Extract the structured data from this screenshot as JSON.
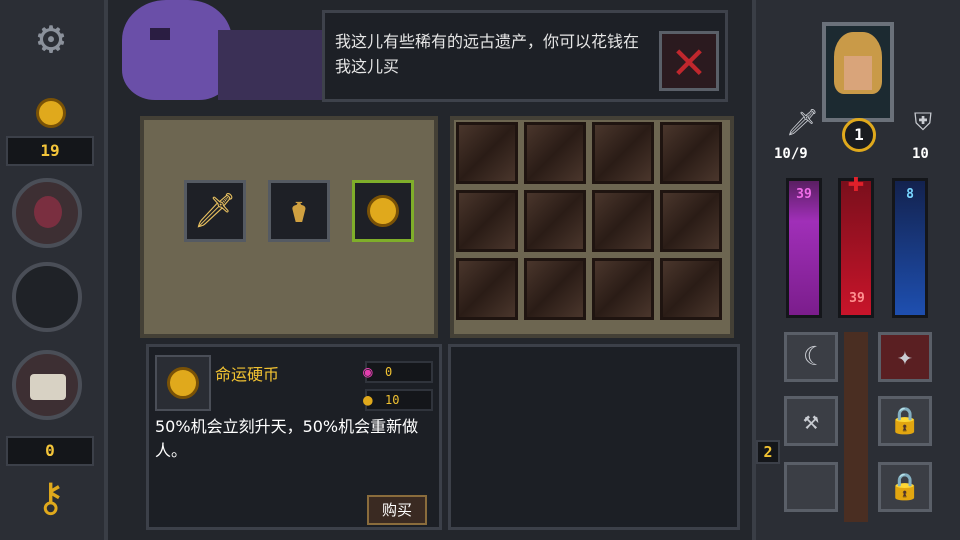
{
  "sidebar": {
    "gold": "19",
    "keys": "0"
  },
  "dialog": {
    "text": "我这儿有些稀有的远古遗产，你可以花钱在我这儿买"
  },
  "shop_items": [
    {
      "name": "sword-item",
      "glyph": "🗡"
    },
    {
      "name": "lantern-item",
      "glyph": "⚱"
    },
    {
      "name": "coin-item",
      "glyph": "●"
    }
  ],
  "item_info": {
    "name": "命运硬币",
    "soul_cost": "0",
    "gold_cost": "10",
    "description": "50%机会立刻升天，50%机会重新做人。",
    "buy_label": "购买"
  },
  "hero": {
    "attack": "10/9",
    "level": "1",
    "defense": "10"
  },
  "bars": {
    "purple": "39",
    "red": "39",
    "blue": "8"
  },
  "floor_number": "2",
  "colors": {
    "gold": "#f1c232",
    "purple_bar": "#a02fb8",
    "red_bar": "#c8142a",
    "blue_bar": "#1e4fb0"
  }
}
